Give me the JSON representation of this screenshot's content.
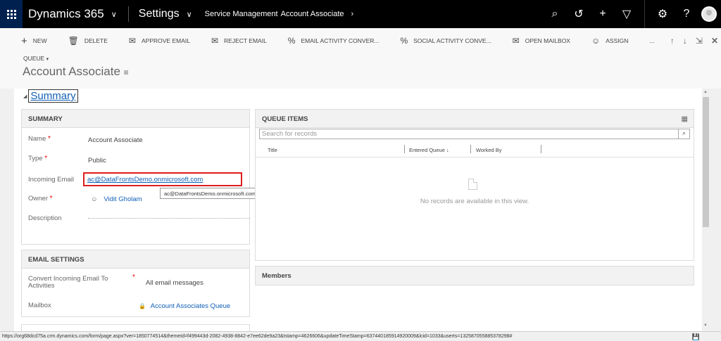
{
  "nav": {
    "app_name": "Dynamics 365",
    "settings_label": "Settings",
    "breadcrumbs": [
      "Service Management",
      "Account Associate"
    ]
  },
  "toolbar": {
    "items": [
      {
        "label": "NEW",
        "icon": "plus-icon"
      },
      {
        "label": "DELETE",
        "icon": "trash-icon"
      },
      {
        "label": "APPROVE EMAIL",
        "icon": "approve-email-icon"
      },
      {
        "label": "REJECT EMAIL",
        "icon": "reject-email-icon"
      },
      {
        "label": "EMAIL ACTIVITY CONVER...",
        "icon": "percent-icon"
      },
      {
        "label": "SOCIAL ACTIVITY CONVE...",
        "icon": "percent-icon"
      },
      {
        "label": "OPEN MAILBOX",
        "icon": "mailbox-icon"
      },
      {
        "label": "ASSIGN",
        "icon": "assign-icon"
      }
    ],
    "more": "..."
  },
  "header": {
    "entity_type": "QUEUE",
    "record_name": "Account Associate"
  },
  "tab": {
    "label": "Summary"
  },
  "summary": {
    "title": "SUMMARY",
    "name_label": "Name",
    "name_value": "Account Associate",
    "type_label": "Type",
    "type_value": "Public",
    "email_label": "Incoming Email",
    "email_value": "ac@DataFrontsDemo.onmicrosoft.com",
    "email_tooltip": "ac@DataFrontsDemo.onmicrosoft.com",
    "owner_label": "Owner",
    "owner_value": "Vidit Gholam",
    "description_label": "Description"
  },
  "email_settings": {
    "title": "EMAIL SETTINGS",
    "convert_label": "Convert Incoming Email To Activities",
    "convert_value": "All email messages",
    "mailbox_label": "Mailbox",
    "mailbox_value": "Account Associates Queue"
  },
  "queue_items": {
    "title": "QUEUE ITEMS",
    "search_placeholder": "Search for records",
    "columns": [
      "Title",
      "Entered Queue ↓",
      "Worked By"
    ],
    "empty_text": "No records are available in this view."
  },
  "members": {
    "title": "Members"
  },
  "status_bar": {
    "url": "https://org68dcd75a.crm.dynamics.com/form/page.aspx?ver=1850774514&themeId=f499443d-2082-4938-8842-e7ee62de9a23&tstamp=4626606&updateTimeStamp=637440185914920009&lcid=1033&userts=132587055885378298#"
  }
}
